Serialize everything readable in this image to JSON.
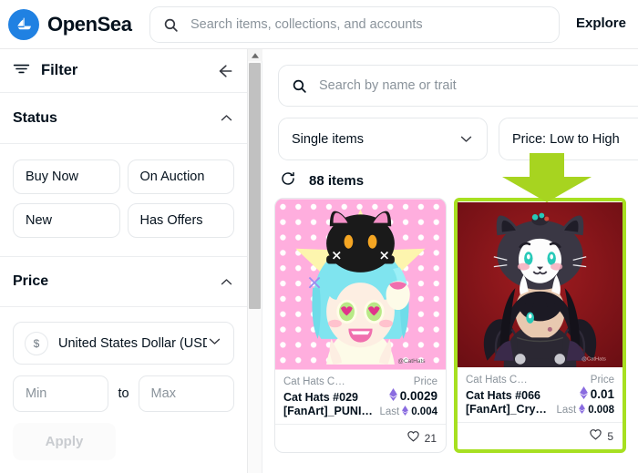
{
  "header": {
    "brand": "OpenSea",
    "logo_icon": "opensea-sailboat-logo",
    "search_placeholder": "Search items, collections, and accounts",
    "search_icon": "search-icon",
    "explore_label": "Explore",
    "brand_color": "#2081e2"
  },
  "sidebar": {
    "filter_label": "Filter",
    "filter_icon": "filter-icon",
    "back_icon": "arrow-left-icon",
    "status": {
      "title": "Status",
      "chevron_icon": "chevron-up-icon",
      "options": [
        "Buy Now",
        "On Auction",
        "New",
        "Has Offers"
      ]
    },
    "price": {
      "title": "Price",
      "chevron_icon": "chevron-up-icon",
      "currency_icon": "dollar-icon",
      "currency_value": "United States Dollar (USD)",
      "currency_chevron": "chevron-down-icon",
      "min_placeholder": "Min",
      "to_label": "to",
      "max_placeholder": "Max",
      "apply_label": "Apply"
    },
    "scrollbar_up_icon": "scroll-up-arrow-icon"
  },
  "main": {
    "trait_search_placeholder": "Search by name or trait",
    "trait_search_icon": "search-icon",
    "type_filter": "Single items",
    "type_chevron": "chevron-down-icon",
    "sort_filter": "Price: Low to High",
    "refresh_icon": "refresh-icon",
    "item_count": "88 items",
    "annotation_arrow_icon": "down-arrow-annotation",
    "annotation_color": "#a7e021",
    "eth_icon": "ethereum-icon",
    "heart_icon": "heart-outline-icon",
    "cards": [
      {
        "collection": "Cat Hats C…",
        "price_label": "Price",
        "name_line1": "Cat Hats #029",
        "name_line2": "[FanArt]_PUNI…",
        "price": "0.0029",
        "last_label": "Last",
        "last_price": "0.004",
        "likes": "21",
        "highlighted": false,
        "art": "anime-girl-blue-hair-black-cat-hat-pink-polkadot"
      },
      {
        "collection": "Cat Hats C…",
        "price_label": "Price",
        "name_line1": "Cat Hats #066",
        "name_line2": "[FanArt]_Cry…",
        "price": "0.01",
        "last_label": "Last",
        "last_price": "0.008",
        "likes": "5",
        "highlighted": true,
        "art": "anime-girl-dark-hair-gray-cat-hat-dark-red"
      }
    ]
  }
}
